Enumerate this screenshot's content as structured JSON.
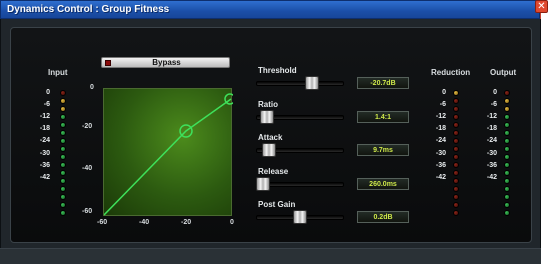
{
  "window": {
    "title": "Dynamics Control : Group Fitness",
    "close_glyph": "✕"
  },
  "meters": {
    "input": {
      "label": "Input",
      "ticks": [
        "0",
        "-6",
        "-12",
        "-18",
        "-24",
        "-30",
        "-36",
        "-42"
      ]
    },
    "reduction": {
      "label": "Reduction",
      "ticks": [
        "0",
        "-6",
        "-12",
        "-18",
        "-24",
        "-30",
        "-36",
        "-42"
      ]
    },
    "output": {
      "label": "Output",
      "ticks": [
        "0",
        "-6",
        "-12",
        "-18",
        "-24",
        "-30",
        "-36",
        "-42"
      ]
    }
  },
  "bypass": {
    "label": "Bypass"
  },
  "graph": {
    "y_ticks": [
      "0",
      "-20",
      "-40",
      "-60"
    ],
    "x_ticks": [
      "-60",
      "-40",
      "-20",
      "0"
    ]
  },
  "controls": [
    {
      "id": "threshold",
      "label": "Threshold",
      "value": "-20.7dB",
      "fraction": 0.66
    },
    {
      "id": "ratio",
      "label": "Ratio",
      "value": "1.4:1",
      "fraction": 0.06
    },
    {
      "id": "attack",
      "label": "Attack",
      "value": "9.7ms",
      "fraction": 0.08
    },
    {
      "id": "release",
      "label": "Release",
      "value": "260.0ms",
      "fraction": 0.0
    },
    {
      "id": "post_gain",
      "label": "Post Gain",
      "value": "0.2dB",
      "fraction": 0.5
    }
  ],
  "colors": {
    "curve": "#3ee05a",
    "led_green": "#3cbf58",
    "led_yellow": "#e0b844",
    "led_red": "#d84a3a",
    "readout_text": "#cfe94a"
  }
}
